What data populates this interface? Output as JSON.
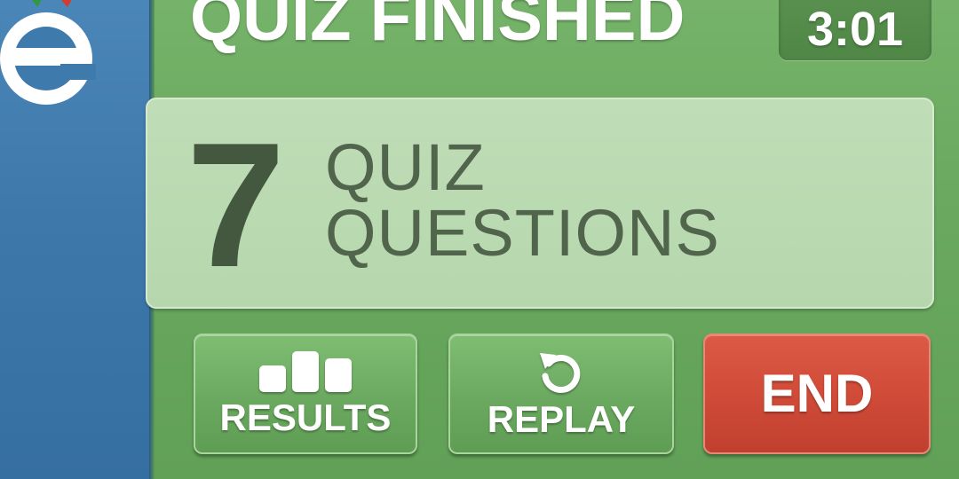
{
  "header": {
    "title": "QUIZ FINISHED",
    "timer": "3:01"
  },
  "summary": {
    "count": "7",
    "label_line1": "QUIZ",
    "label_line2": "QUESTIONS"
  },
  "buttons": {
    "results_label": "RESULTS",
    "replay_label": "REPLAY",
    "end_label": "END"
  },
  "icons": {
    "results": "bar-chart-icon",
    "replay": "replay-icon",
    "logo": "app-logo"
  },
  "colors": {
    "sidebar": "#3e78ab",
    "panel_green": "#6aa95f",
    "info_panel": "#bfddb7",
    "end_red": "#cf4a37",
    "text_dark": "#44573f"
  }
}
